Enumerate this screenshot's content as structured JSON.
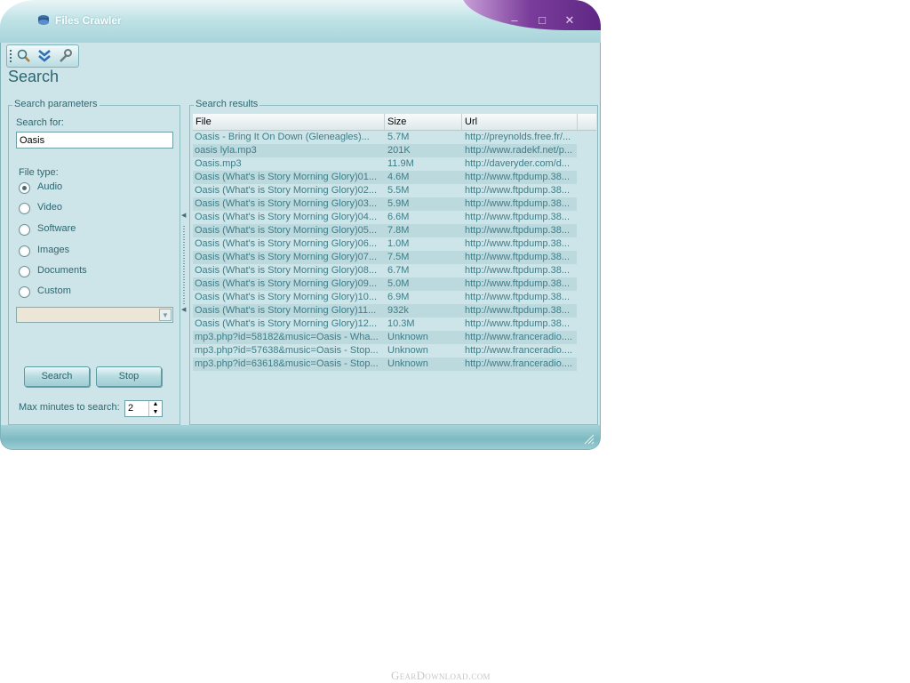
{
  "window": {
    "title": "Files Crawler"
  },
  "toolbar": {
    "icons": [
      "search-icon",
      "chevrons-down-icon",
      "wrench-icon"
    ]
  },
  "page_title": "Search",
  "params": {
    "legend": "Search parameters",
    "search_for_label": "Search for:",
    "search_value": "Oasis",
    "file_type_label": "File type:",
    "file_types": [
      "Audio",
      "Video",
      "Software",
      "Images",
      "Documents",
      "Custom"
    ],
    "selected_file_type": "Audio",
    "search_button": "Search",
    "stop_button": "Stop",
    "max_minutes_label": "Max minutes to search:",
    "max_minutes_value": "2"
  },
  "results": {
    "legend": "Search results",
    "columns": [
      "File",
      "Size",
      "Url"
    ],
    "rows": [
      {
        "file": "Oasis - Bring It On Down (Gleneagles)...",
        "size": "5.7M",
        "url": "http://preynolds.free.fr/..."
      },
      {
        "file": "oasis lyla.mp3",
        "size": "201K",
        "url": "http://www.radekf.net/p..."
      },
      {
        "file": "Oasis.mp3",
        "size": "11.9M",
        "url": "http://daveryder.com/d..."
      },
      {
        "file": "Oasis (What's is Story Morning Glory)01...",
        "size": "4.6M",
        "url": "http://www.ftpdump.38..."
      },
      {
        "file": "Oasis (What's is Story Morning Glory)02...",
        "size": "5.5M",
        "url": "http://www.ftpdump.38..."
      },
      {
        "file": "Oasis (What's is Story Morning Glory)03...",
        "size": "5.9M",
        "url": "http://www.ftpdump.38..."
      },
      {
        "file": "Oasis (What's is Story Morning Glory)04...",
        "size": "6.6M",
        "url": "http://www.ftpdump.38..."
      },
      {
        "file": "Oasis (What's is Story Morning Glory)05...",
        "size": "7.8M",
        "url": "http://www.ftpdump.38..."
      },
      {
        "file": "Oasis (What's is Story Morning Glory)06...",
        "size": "1.0M",
        "url": "http://www.ftpdump.38..."
      },
      {
        "file": "Oasis (What's is Story Morning Glory)07...",
        "size": "7.5M",
        "url": "http://www.ftpdump.38..."
      },
      {
        "file": "Oasis (What's is Story Morning Glory)08...",
        "size": "6.7M",
        "url": "http://www.ftpdump.38..."
      },
      {
        "file": "Oasis (What's is Story Morning Glory)09...",
        "size": "5.0M",
        "url": "http://www.ftpdump.38..."
      },
      {
        "file": "Oasis (What's is Story Morning Glory)10...",
        "size": "6.9M",
        "url": "http://www.ftpdump.38..."
      },
      {
        "file": "Oasis (What's is Story Morning Glory)11...",
        "size": "932k",
        "url": "http://www.ftpdump.38..."
      },
      {
        "file": "Oasis (What's is Story Morning Glory)12...",
        "size": "10.3M",
        "url": "http://www.ftpdump.38..."
      },
      {
        "file": "mp3.php?id=58182&music=Oasis - Wha...",
        "size": "Unknown",
        "url": "http://www.franceradio...."
      },
      {
        "file": "mp3.php?id=57638&music=Oasis - Stop...",
        "size": "Unknown",
        "url": "http://www.franceradio...."
      },
      {
        "file": "mp3.php?id=63618&music=Oasis - Stop...",
        "size": "Unknown",
        "url": "http://www.franceradio...."
      }
    ]
  },
  "watermark": "GearDownload.com",
  "colors": {
    "accent_purple": "#6b2e8f",
    "frame_teal": "#a6d3d9",
    "text_teal": "#2d6670"
  }
}
